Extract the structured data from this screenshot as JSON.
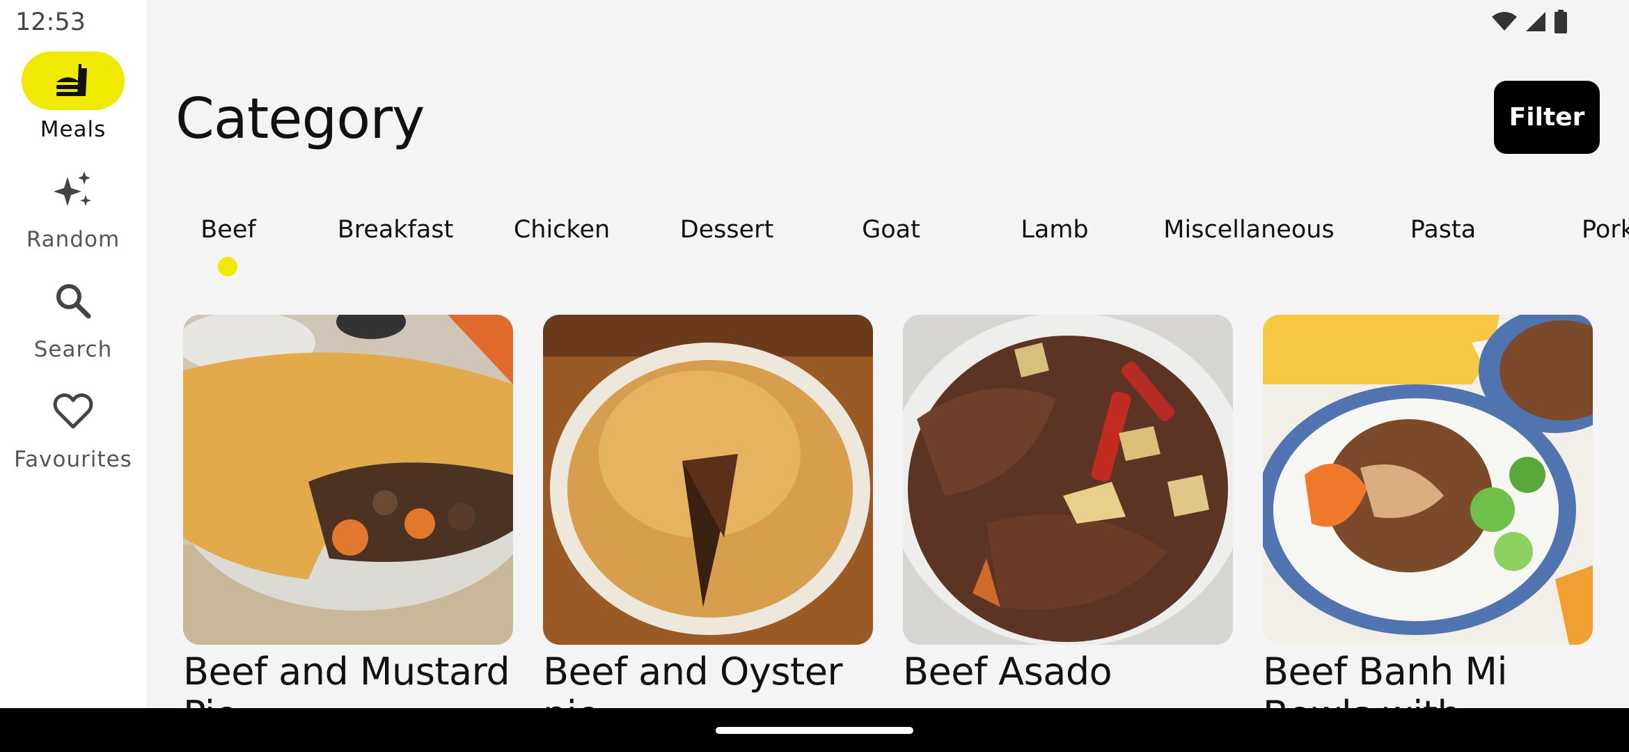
{
  "status_bar": {
    "time": "12:53"
  },
  "nav_rail": {
    "items": [
      {
        "label": "Meals",
        "icon": "meals-icon",
        "active": true
      },
      {
        "label": "Random",
        "icon": "sparkle-icon",
        "active": false
      },
      {
        "label": "Search",
        "icon": "search-icon",
        "active": false
      },
      {
        "label": "Favourites",
        "icon": "heart-icon",
        "active": false
      }
    ]
  },
  "header": {
    "title": "Category",
    "filter_label": "Filter"
  },
  "tabs": [
    {
      "label": "Beef",
      "selected": true
    },
    {
      "label": "Breakfast"
    },
    {
      "label": "Chicken"
    },
    {
      "label": "Dessert"
    },
    {
      "label": "Goat"
    },
    {
      "label": "Lamb"
    },
    {
      "label": "Miscellaneous"
    },
    {
      "label": "Pasta"
    },
    {
      "label": "Pork"
    }
  ],
  "meals": [
    {
      "name": "Beef and Mustard Pie"
    },
    {
      "name": "Beef and Oyster pie"
    },
    {
      "name": "Beef Asado"
    },
    {
      "name": "Beef Banh Mi Bowls with Sriracha Mayo"
    }
  ],
  "colors": {
    "accent": "#f0ea00",
    "button": "#000000",
    "rail": "#ffffff",
    "background": "#f4f4f4"
  }
}
